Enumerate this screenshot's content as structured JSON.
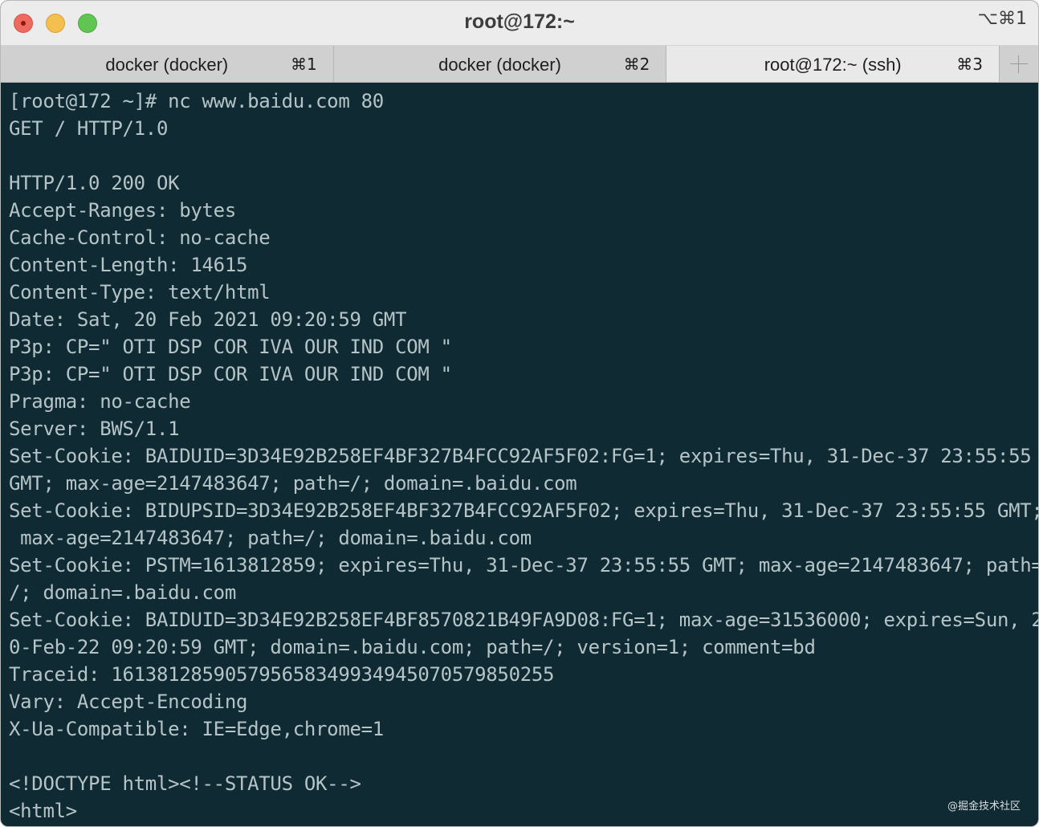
{
  "window": {
    "title": "root@172:~",
    "shortcut": "⌥⌘1"
  },
  "tabs": [
    {
      "label": "docker (docker)",
      "key": "⌘1",
      "active": false
    },
    {
      "label": "docker (docker)",
      "key": "⌘2",
      "active": false
    },
    {
      "label": "root@172:~ (ssh)",
      "key": "⌘3",
      "active": true
    }
  ],
  "terminal": {
    "lines": [
      "[root@172 ~]# nc www.baidu.com 80",
      "GET / HTTP/1.0",
      "",
      "HTTP/1.0 200 OK",
      "Accept-Ranges: bytes",
      "Cache-Control: no-cache",
      "Content-Length: 14615",
      "Content-Type: text/html",
      "Date: Sat, 20 Feb 2021 09:20:59 GMT",
      "P3p: CP=\" OTI DSP COR IVA OUR IND COM \"",
      "P3p: CP=\" OTI DSP COR IVA OUR IND COM \"",
      "Pragma: no-cache",
      "Server: BWS/1.1",
      "Set-Cookie: BAIDUID=3D34E92B258EF4BF327B4FCC92AF5F02:FG=1; expires=Thu, 31-Dec-37 23:55:55",
      "GMT; max-age=2147483647; path=/; domain=.baidu.com",
      "Set-Cookie: BIDUPSID=3D34E92B258EF4BF327B4FCC92AF5F02; expires=Thu, 31-Dec-37 23:55:55 GMT;",
      " max-age=2147483647; path=/; domain=.baidu.com",
      "Set-Cookie: PSTM=1613812859; expires=Thu, 31-Dec-37 23:55:55 GMT; max-age=2147483647; path=",
      "/; domain=.baidu.com",
      "Set-Cookie: BAIDUID=3D34E92B258EF4BF8570821B49FA9D08:FG=1; max-age=31536000; expires=Sun, 2",
      "0-Feb-22 09:20:59 GMT; domain=.baidu.com; path=/; version=1; comment=bd",
      "Traceid: 161381285905795658349934945070579850255",
      "Vary: Accept-Encoding",
      "X-Ua-Compatible: IE=Edge,chrome=1",
      "",
      "<!DOCTYPE html><!--STATUS OK-->",
      "<html>"
    ]
  },
  "watermark": "@掘金技术社区"
}
